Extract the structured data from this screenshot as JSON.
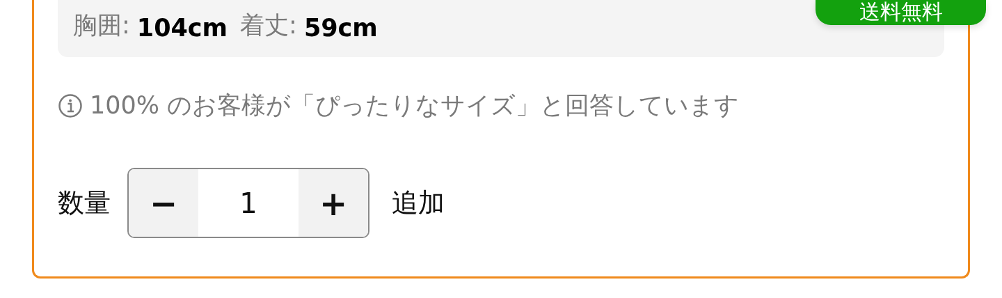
{
  "badge": {
    "label": "送料無料"
  },
  "measurements": [
    {
      "label": "胸囲:",
      "value": "104cm"
    },
    {
      "label": "着丈:",
      "value": "59cm"
    }
  ],
  "fit_note": "100% のお客様が「ぴったりなサイズ」と回答しています",
  "quantity": {
    "label": "数量",
    "minus": "−",
    "value": "1",
    "plus": "+",
    "add_label": "追加"
  }
}
